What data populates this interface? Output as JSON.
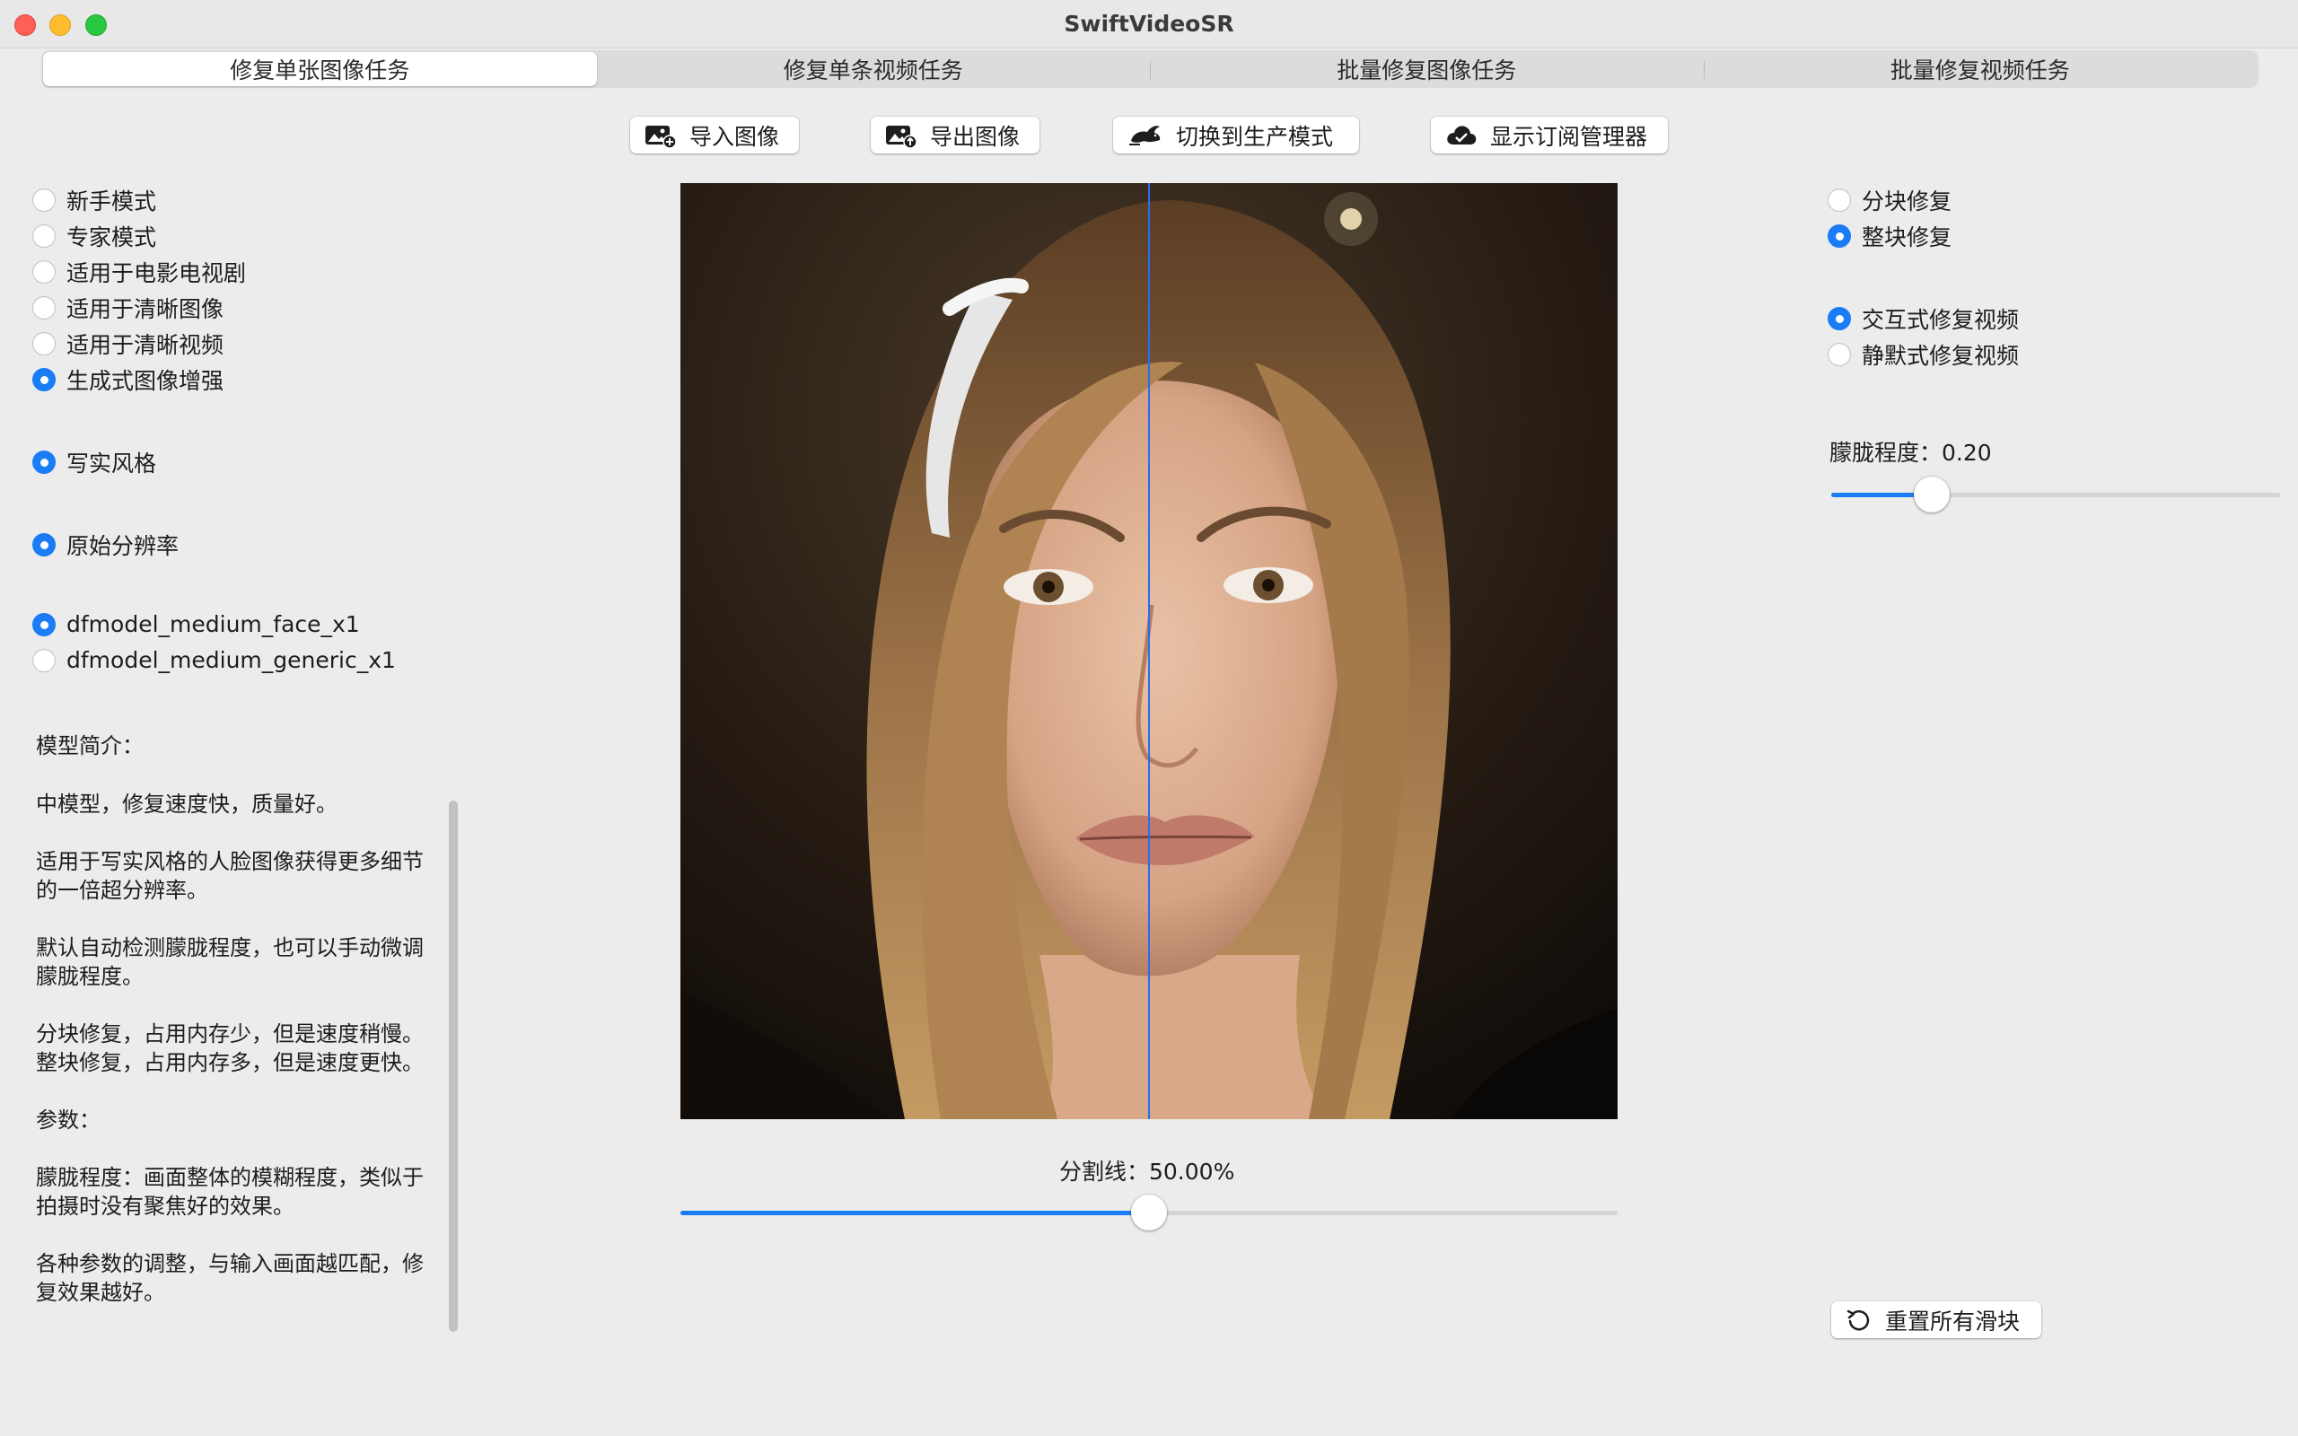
{
  "window": {
    "title": "SwiftVideoSR"
  },
  "tabs": [
    {
      "label": "修复单张图像任务",
      "active": true
    },
    {
      "label": "修复单条视频任务",
      "active": false
    },
    {
      "label": "批量修复图像任务",
      "active": false
    },
    {
      "label": "批量修复视频任务",
      "active": false
    }
  ],
  "toolbar": {
    "import_label": "导入图像",
    "export_label": "导出图像",
    "mode_label": "切换到生产模式",
    "subscription_label": "显示订阅管理器"
  },
  "left": {
    "mode_options": [
      {
        "label": "新手模式",
        "selected": false
      },
      {
        "label": "专家模式",
        "selected": false
      },
      {
        "label": "适用于电影电视剧",
        "selected": false
      },
      {
        "label": "适用于清晰图像",
        "selected": false
      },
      {
        "label": "适用于清晰视频",
        "selected": false
      },
      {
        "label": "生成式图像增强",
        "selected": true
      }
    ],
    "style_option": {
      "label": "写实风格",
      "selected": true
    },
    "resolution_option": {
      "label": "原始分辨率",
      "selected": true
    },
    "model_options": [
      {
        "label": "dfmodel_medium_face_x1",
        "selected": true
      },
      {
        "label": "dfmodel_medium_generic_x1",
        "selected": false
      }
    ],
    "description": {
      "title": "模型简介：",
      "paragraphs": [
        "中模型，修复速度快，质量好。",
        "适用于写实风格的人脸图像获得更多细节的一倍超分辨率。",
        "默认自动检测朦胧程度，也可以手动微调朦胧程度。",
        "分块修复，占用内存少，但是速度稍慢。整块修复，占用内存多，但是速度更快。",
        "参数：",
        "朦胧程度：画面整体的模糊程度，类似于拍摄时没有聚焦好的效果。",
        "各种参数的调整，与输入画面越匹配，修复效果越好。"
      ]
    }
  },
  "center": {
    "split_label": "分割线：50.00%",
    "split_value": 0.5
  },
  "right": {
    "tile_options": [
      {
        "label": "分块修复",
        "selected": false
      },
      {
        "label": "整块修复",
        "selected": true
      }
    ],
    "video_options": [
      {
        "label": "交互式修复视频",
        "selected": true
      },
      {
        "label": "静默式修复视频",
        "selected": false
      }
    ],
    "haze_label": "朦胧程度：0.20",
    "haze_value": 0.2,
    "reset_label": "重置所有滑块"
  },
  "colors": {
    "accent": "#1a7df5",
    "split_line": "#2a6cf0"
  }
}
